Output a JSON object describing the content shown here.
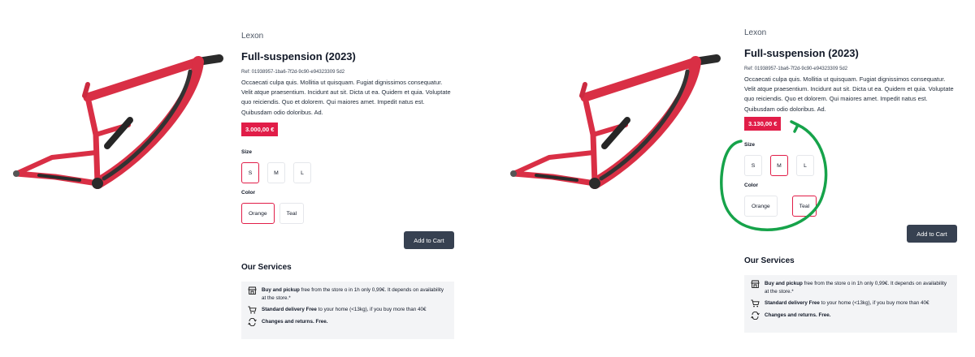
{
  "colors": {
    "accent": "#e11d48",
    "button": "#374151",
    "annotation": "#16a34a",
    "bike_frame": "#d92f45"
  },
  "before": {
    "product": {
      "image_icon": "bike-frame-image",
      "brand": "Lexon",
      "title": "Full-suspension (2023)",
      "ref": "Ref: 01938957-1ba6-7f2d-9c90-e94323309 5d2",
      "description": "Occaecati culpa quis. Mollitia ut quisquam. Fugiat dignissimos consequatur. Velit atque praesentium. Incidunt aut sit. Dicta ut ea. Quidem et quia. Voluptate quo reiciendis. Quo et dolorem. Qui maiores amet. Impedit natus est. Quibusdam odio doloribus. Ad.",
      "price": "3.000,00 €"
    },
    "size": {
      "label": "Size",
      "options": [
        "S",
        "M",
        "L"
      ],
      "selected": "S"
    },
    "color": {
      "label": "Color",
      "options": [
        "Orange",
        "Teal"
      ],
      "selected": "Orange"
    },
    "cart_button": "Add to Cart",
    "services": {
      "title": "Our Services",
      "items": [
        {
          "icon": "store-icon",
          "bold": "Buy and pickup",
          "text": " free from the store o in 1h only 0,99€. It depends on availability at the store.*"
        },
        {
          "icon": "cart-icon",
          "bold": "Standard delivery Free",
          "text": " to your home (<13kg), if you buy more than 40€"
        },
        {
          "icon": "returns-icon",
          "bold": "Changes and returns. Free.",
          "text": ""
        }
      ]
    }
  },
  "after": {
    "product": {
      "image_icon": "bike-frame-image",
      "brand": "Lexon",
      "title": "Full-suspension (2023)",
      "ref": "Ref: 01938957-1ba6-7f2d-9c90-e94323309 5d2",
      "description": "Occaecati culpa quis. Mollitia ut quisquam. Fugiat dignissimos consequatur. Velit atque praesentium. Incidunt aut sit. Dicta ut ea. Quidem et quia. Voluptate quo reiciendis. Quo et dolorem. Qui maiores amet. Impedit natus est. Quibusdam odio doloribus. Ad.",
      "price": "3.130,00 €"
    },
    "size": {
      "label": "Size",
      "options": [
        "S",
        "M",
        "L"
      ],
      "selected": "M"
    },
    "color": {
      "label": "Color",
      "options": [
        "Orange",
        "Teal"
      ],
      "selected": "Teal"
    },
    "cart_button": "Add to Cart",
    "services": {
      "title": "Our Services",
      "items": [
        {
          "icon": "store-icon",
          "bold": "Buy and pickup",
          "text": " free from the store o in 1h only 0,99€. It depends on availability at the store.*"
        },
        {
          "icon": "cart-icon",
          "bold": "Standard delivery Free",
          "text": " to your home (<13kg), if you buy more than 40€"
        },
        {
          "icon": "returns-icon",
          "bold": "Changes and returns. Free.",
          "text": ""
        }
      ]
    }
  }
}
